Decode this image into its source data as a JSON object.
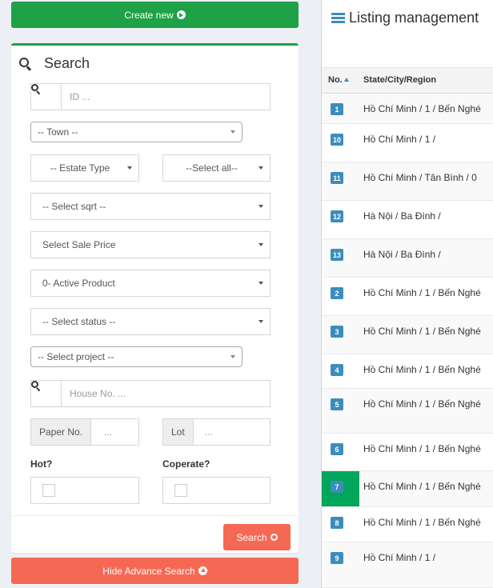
{
  "left": {
    "create_button": "Create new",
    "search_title": "Search",
    "fields": {
      "id_placeholder": "ID ...",
      "town": "-- Town --",
      "estate_type": "-- Estate Type",
      "select_all": "--Select all--",
      "sqrt": "-- Select sqrt --",
      "sale_price": "Select Sale Price",
      "active_product": "0- Active Product",
      "status": "-- Select status --",
      "project": "-- Select project --",
      "house_placeholder": "House No. ...",
      "paper_label": "Paper No.",
      "paper_placeholder": "...",
      "lot_label": "Lot",
      "lot_placeholder": "..."
    },
    "hot_label": "Hot?",
    "coperate_label": "Coperate?",
    "search_button": "Search",
    "hide_button": "Hide Advance Search"
  },
  "right": {
    "title": "Listing management",
    "columns": {
      "no": "No.",
      "location": "State/City/Region"
    },
    "rows": [
      {
        "no": "1",
        "location": "Hồ Chí Minh / 1 / Bến Nghé"
      },
      {
        "no": "10",
        "location": "Hồ Chí Minh / 1 /"
      },
      {
        "no": "11",
        "location": "Hồ Chí Minh / Tân Bình / 0"
      },
      {
        "no": "12",
        "location": "Hà Nội / Ba Đình /"
      },
      {
        "no": "13",
        "location": "Hà Nội / Ba Đình /"
      },
      {
        "no": "2",
        "location": "Hồ Chí Minh / 1 / Bến Nghé"
      },
      {
        "no": "3",
        "location": "Hồ Chí Minh / 1 / Bến Nghé"
      },
      {
        "no": "4",
        "location": "Hồ Chí Minh / 1 / Bến Nghé"
      },
      {
        "no": "5",
        "location": "Hồ Chí Minh / 1 / Bến Nghé"
      },
      {
        "no": "6",
        "location": "Hồ Chí Minh / 1 / Bến Nghé"
      },
      {
        "no": "7",
        "location": "Hồ Chí Minh / 1 / Bến Nghé"
      },
      {
        "no": "8",
        "location": "Hồ Chí Minh / 1 / Bến Nghé"
      },
      {
        "no": "9",
        "location": "Hồ Chí Minh / 1 /"
      }
    ]
  },
  "colors": {
    "green": "#1fa147",
    "red": "#f56954",
    "blue": "#3c8dbc",
    "highlight": "#00a65a"
  }
}
